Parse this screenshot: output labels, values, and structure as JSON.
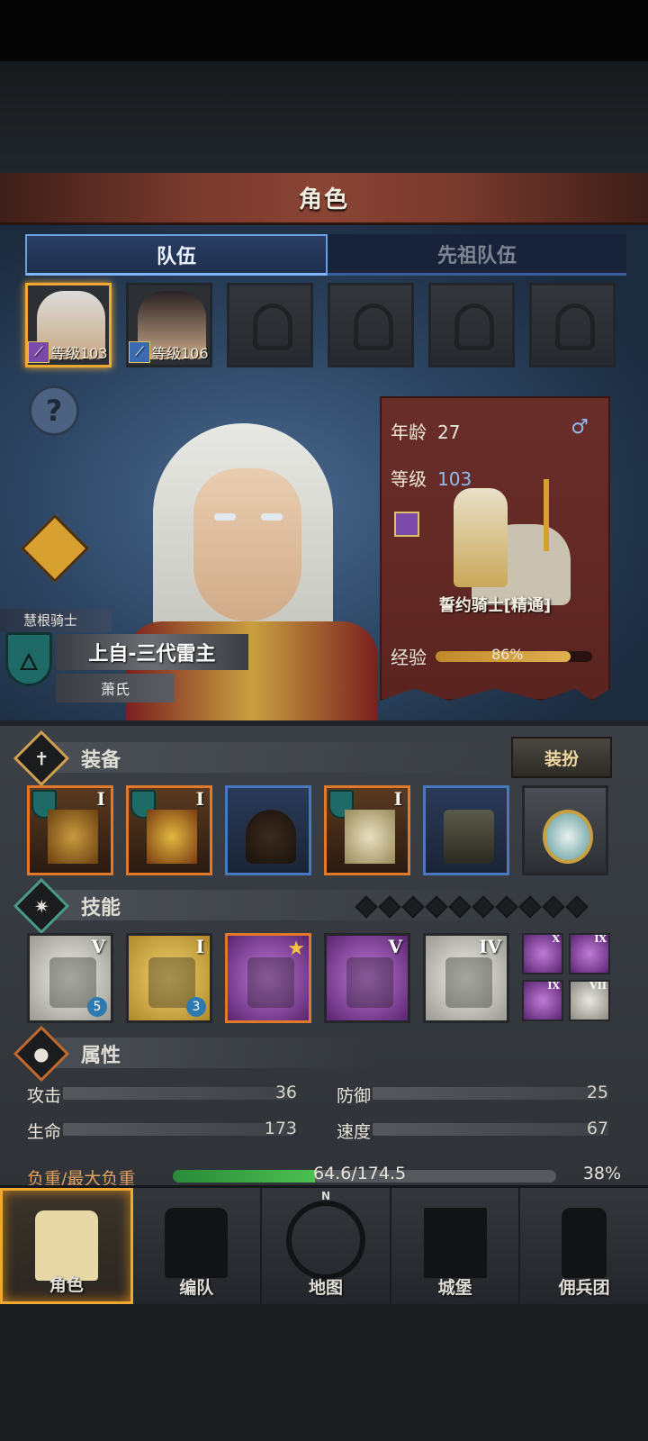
{
  "header": {
    "title": "角色"
  },
  "tabs": [
    {
      "label": "队伍"
    },
    {
      "label": "先祖队伍"
    }
  ],
  "team": [
    {
      "level_label": "等级103",
      "selected": true
    },
    {
      "level_label": "等级106",
      "selected": false
    }
  ],
  "hero": {
    "clan": "慧根骑士",
    "title": "上自-三代雷主",
    "surname": "萧氏"
  },
  "info": {
    "age_label": "年龄",
    "age": "27",
    "level_label": "等级",
    "level": "103",
    "gender_symbol": "♂",
    "unit_name": "誓约骑士[精通]",
    "exp_label": "经验",
    "exp_pct_text": "86%",
    "exp_fraction": 0.86
  },
  "equipment": {
    "title": "装备",
    "dress_button": "装扮",
    "tiers": [
      "I",
      "I",
      "",
      "I",
      "",
      ""
    ]
  },
  "skills": {
    "title": "技能",
    "main": [
      {
        "tier": "V",
        "count": "5"
      },
      {
        "tier": "I",
        "count": "3"
      },
      {
        "tier": "",
        "count": ""
      },
      {
        "tier": "V",
        "count": ""
      },
      {
        "tier": "IV",
        "count": ""
      }
    ],
    "mini": [
      {
        "tier": "X"
      },
      {
        "tier": "IX"
      },
      {
        "tier": "IX"
      },
      {
        "tier": "VII"
      }
    ]
  },
  "attributes": {
    "title": "属性",
    "attack_label": "攻击",
    "attack": "36",
    "defense_label": "防御",
    "defense": "25",
    "hp_label": "生命",
    "hp": "173",
    "speed_label": "速度",
    "speed": "67",
    "load_label": "负重/最大负重",
    "load_text": "64.6/174.5",
    "load_pct": "38%",
    "load_fraction": 0.37
  },
  "nav": [
    {
      "label": "角色"
    },
    {
      "label": "编队"
    },
    {
      "label": "地图",
      "compass": "N"
    },
    {
      "label": "城堡"
    },
    {
      "label": "佣兵团"
    }
  ],
  "colors": {
    "accent": "#f0a830",
    "title_bar": "#7a3a2e",
    "panel_blue": "#2e4766",
    "card_red": "#6a2e2a"
  }
}
